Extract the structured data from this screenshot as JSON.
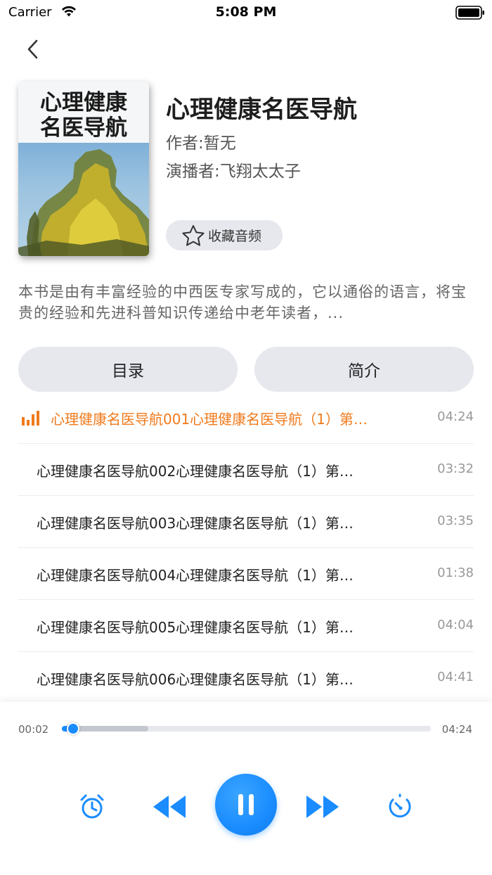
{
  "status_bar": {
    "carrier": "Carrier",
    "time": "5:08 PM"
  },
  "book": {
    "cover_title_line1": "心理健康",
    "cover_title_line2": "名医导航",
    "title": "心理健康名医导航",
    "author": "作者:暂无",
    "narrator": "演播者:飞翔太太子",
    "favorite_label": "收藏音频",
    "description": "本书是由有丰富经验的中西医专家写成的，它以通俗的语言，将宝贵的经验和先进科普知识传递给中老年读者，..."
  },
  "tabs": {
    "catalog": "目录",
    "intro": "简介"
  },
  "tracks": [
    {
      "title": "心理健康名医导航001心理健康名医导航（1）第…",
      "duration": "04:24",
      "active": true
    },
    {
      "title": "心理健康名医导航002心理健康名医导航（1）第…",
      "duration": "03:32"
    },
    {
      "title": "心理健康名医导航003心理健康名医导航（1）第…",
      "duration": "03:35"
    },
    {
      "title": "心理健康名医导航004心理健康名医导航（1）第…",
      "duration": "01:38"
    },
    {
      "title": "心理健康名医导航005心理健康名医导航（1）第…",
      "duration": "04:04"
    },
    {
      "title": "心理健康名医导航006心理健康名医导航（1）第…",
      "duration": "04:41"
    }
  ],
  "player": {
    "current_time": "00:02",
    "total_time": "04:24",
    "progress": 0.03,
    "state": "playing"
  },
  "colors": {
    "accent": "#1a8cff",
    "active_track": "#f07a1c",
    "pill_bg": "#e6e8ee"
  },
  "icons": {
    "back": "chevron-left-icon",
    "favorite": "star-outline-icon",
    "playing": "equalizer-bars-icon",
    "timer": "alarm-clock-icon",
    "rewind": "rewind-icon",
    "pause": "pause-icon",
    "forward": "fast-forward-icon",
    "speed": "speed-dial-icon"
  }
}
